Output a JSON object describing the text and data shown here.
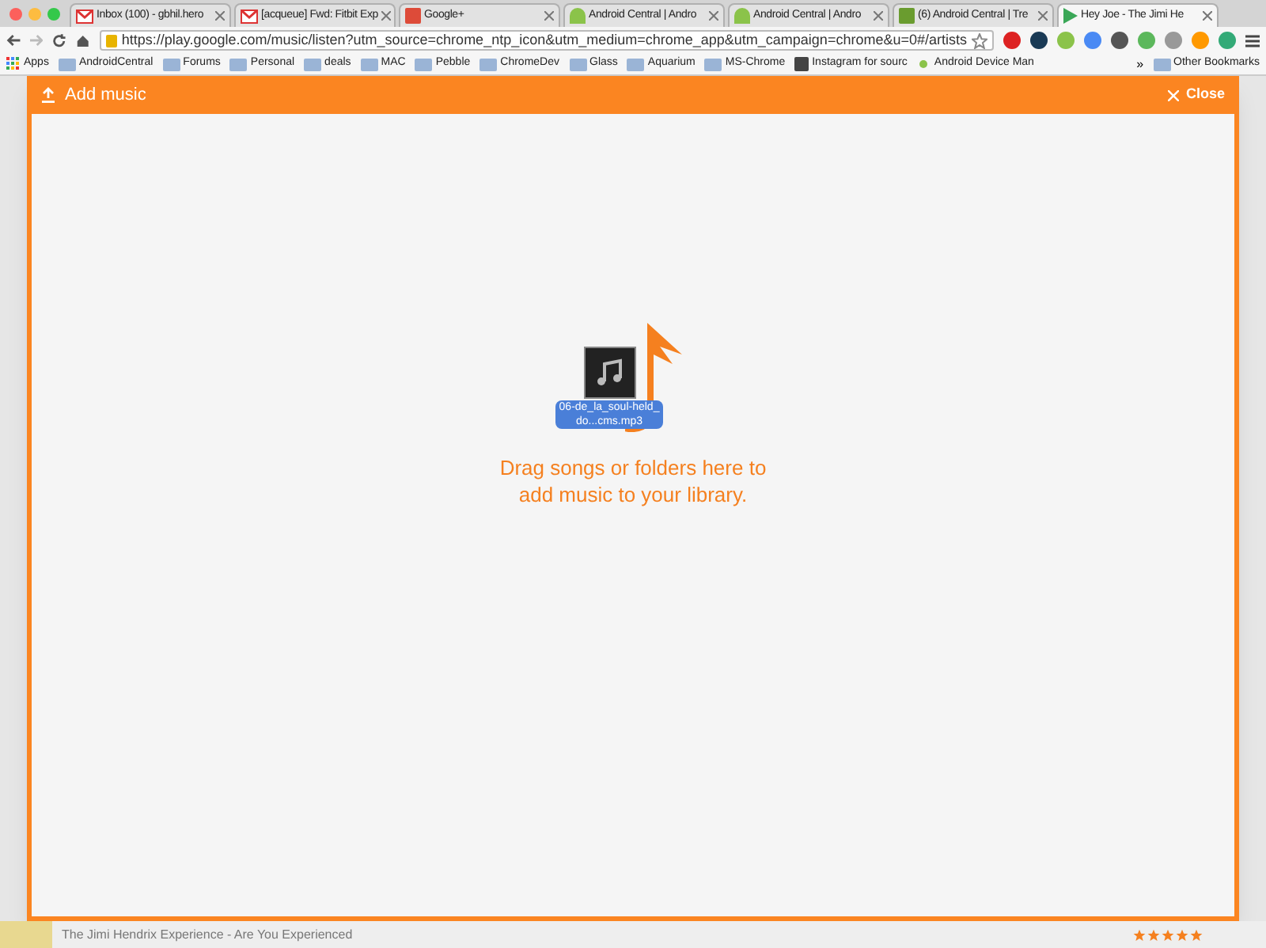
{
  "tabs": [
    {
      "title": "Inbox (100) - gbhil.hero",
      "kind": "mail",
      "selected": false
    },
    {
      "title": "[acqueue] Fwd: Fitbit Exp",
      "kind": "mail",
      "selected": false
    },
    {
      "title": "Google+",
      "kind": "gplus",
      "selected": false
    },
    {
      "title": "Android Central | Andro",
      "kind": "android",
      "selected": false
    },
    {
      "title": "Android Central | Andro",
      "kind": "android",
      "selected": false
    },
    {
      "title": "(6) Android Central | Tre",
      "kind": "trello",
      "selected": false
    },
    {
      "title": "Hey Joe - The Jimi He",
      "kind": "play",
      "selected": true
    }
  ],
  "address_bar": {
    "url": "https://play.google.com/music/listen?utm_source=chrome_ntp_icon&utm_medium=chrome_app&utm_campaign=chrome&u=0#/artists"
  },
  "bookmarks": [
    {
      "label": "Apps",
      "kind": "apps"
    },
    {
      "label": "AndroidCentral",
      "kind": "folder"
    },
    {
      "label": "Forums",
      "kind": "folder"
    },
    {
      "label": "Personal",
      "kind": "folder"
    },
    {
      "label": "deals",
      "kind": "folder"
    },
    {
      "label": "MAC",
      "kind": "folder"
    },
    {
      "label": "Pebble",
      "kind": "folder"
    },
    {
      "label": "ChromeDev",
      "kind": "folder"
    },
    {
      "label": "Glass",
      "kind": "folder"
    },
    {
      "label": "Aquarium",
      "kind": "folder"
    },
    {
      "label": "MS-Chrome",
      "kind": "folder"
    },
    {
      "label": "Instagram for sourc",
      "kind": "site"
    },
    {
      "label": "Android Device Man",
      "kind": "dot"
    }
  ],
  "bookmarks_overflow": "»",
  "other_bookmarks": "Other Bookmarks",
  "dialog": {
    "title": "Add music",
    "close": "Close",
    "file_label": "06-de_la_soul-held_do...cms.mp3",
    "message": "Drag songs or folders here to add music to your library."
  },
  "player": {
    "album_artist": "The Jimi Hendrix Experience - Are You Experienced",
    "stars": 5
  }
}
